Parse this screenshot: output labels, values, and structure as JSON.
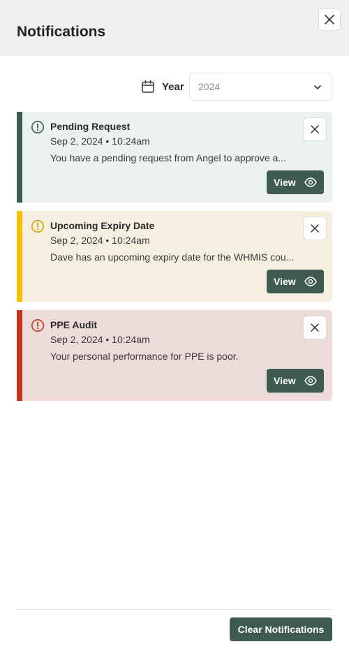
{
  "header": {
    "title": "Notifications",
    "close_icon": "close-icon"
  },
  "filter": {
    "label": "Year",
    "selected": "2024",
    "calendar_icon": "calendar-icon"
  },
  "notifications": [
    {
      "title": "Pending Request",
      "date": "Sep 2, 2024 • 10:24am",
      "message": "You have a pending request from Angel to approve a...",
      "view_label": "View",
      "accent_color": "#3d5a4f",
      "bg_color": "#ebf2ed",
      "icon_color": "#3d5a4f"
    },
    {
      "title": "Upcoming Expiry Date",
      "date": "Sep 2, 2024 • 10:24am",
      "message": "Dave has an upcoming expiry date for the WHMIS cou...",
      "view_label": "View",
      "accent_color": "#f5c400",
      "bg_color": "#f5efdf",
      "icon_color": "#d9a400"
    },
    {
      "title": "PPE Audit",
      "date": "Sep 2, 2024 • 10:24am",
      "message": "Your personal performance for PPE is poor.",
      "view_label": "View",
      "accent_color": "#c0361a",
      "bg_color": "#eddbd9",
      "icon_color": "#c0361a"
    }
  ],
  "footer": {
    "clear_label": "Clear Notifications"
  }
}
